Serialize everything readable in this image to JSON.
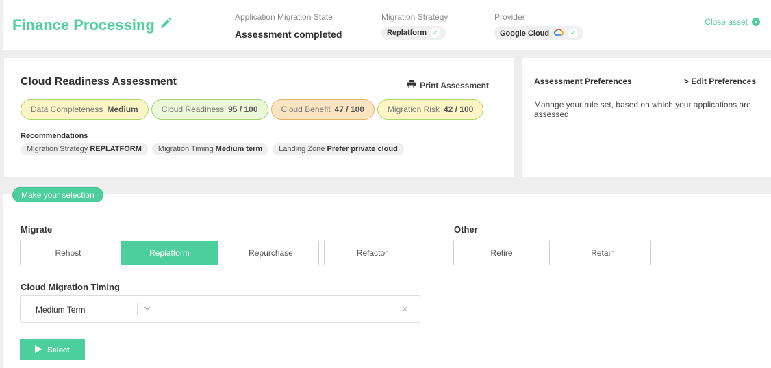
{
  "header": {
    "asset_title": "Finance Processing",
    "state_label": "Application Migration State",
    "state_value": "Assessment completed",
    "strategy_label": "Migration Strategy",
    "strategy_value": "Replatform",
    "provider_label": "Provider",
    "provider_value": "Google Cloud",
    "close_label": "Close asset"
  },
  "assessment": {
    "title": "Cloud Readiness Assessment",
    "print_label": "Print Assessment",
    "badges": [
      {
        "label": "Data Completeness",
        "value": "Medium"
      },
      {
        "label": "Cloud Readiness",
        "value": "95 / 100"
      },
      {
        "label": "Cloud Benefit",
        "value": "47 / 100"
      },
      {
        "label": "Migration Risk",
        "value": "42 / 100"
      }
    ],
    "recommendations_label": "Recommendations",
    "recommendations": [
      {
        "label": "Migration Strategy",
        "value": "REPLATFORM"
      },
      {
        "label": "Migration Timing",
        "value": "Medium term"
      },
      {
        "label": "Landing Zone",
        "value": "Prefer private cloud"
      }
    ]
  },
  "preferences": {
    "title": "Assessment Preferences",
    "edit_label": "Edit Preferences",
    "description": "Manage your rule set, based on which your applications are assessed."
  },
  "selection": {
    "pill_label": "Make your selection",
    "migrate_label": "Migrate",
    "migrate_options": [
      "Rehost",
      "Replatform",
      "Repurchase",
      "Refactor"
    ],
    "other_label": "Other",
    "other_options": [
      "Retire",
      "Retain"
    ],
    "selected": "Replatform",
    "timing_label": "Cloud Migration Timing",
    "timing_value": "Medium Term",
    "timing_clear": "×",
    "select_label": "Select"
  },
  "colors": {
    "accent": "#4ccf9c",
    "badge_yellow": "#fdf5c6",
    "badge_green": "#ecf6d8",
    "badge_orange": "#fbe4c2"
  },
  "icons": [
    "pencil-icon",
    "check-icon",
    "google-cloud-icon",
    "close-circle-icon",
    "printer-icon",
    "chevron-right-icon",
    "chevron-down-icon",
    "clear-icon",
    "play-icon"
  ]
}
